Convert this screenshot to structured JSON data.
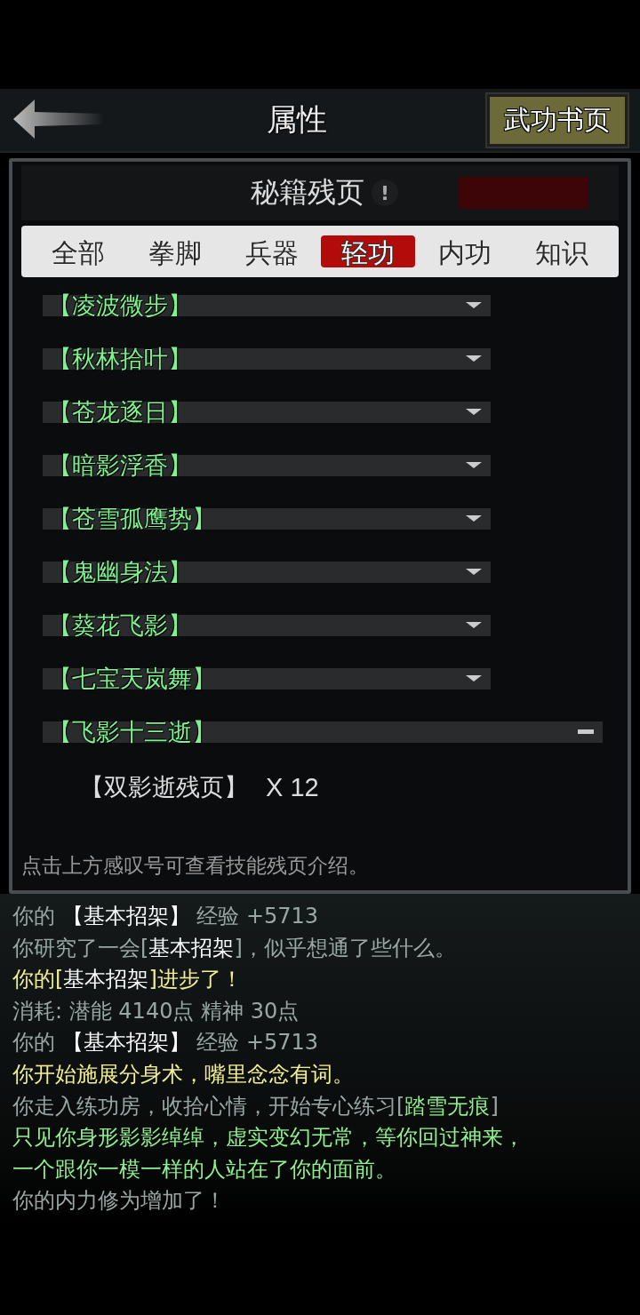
{
  "header": {
    "title": "属性",
    "action": "武功书页"
  },
  "panel": {
    "title": "秘籍残页",
    "info": "!",
    "categories": [
      {
        "label": "全部",
        "selected": false
      },
      {
        "label": "拳脚",
        "selected": false
      },
      {
        "label": "兵器",
        "selected": false
      },
      {
        "label": "轻功",
        "selected": true
      },
      {
        "label": "内功",
        "selected": false
      },
      {
        "label": "知识",
        "selected": false
      }
    ],
    "skills": [
      {
        "name": "【凌波微步】",
        "expanded": false
      },
      {
        "name": "【秋林拾叶】",
        "expanded": false
      },
      {
        "name": "【苍龙逐日】",
        "expanded": false
      },
      {
        "name": "【暗影浮香】",
        "expanded": false
      },
      {
        "name": "【苍雪孤鹰势】",
        "expanded": false
      },
      {
        "name": "【鬼幽身法】",
        "expanded": false
      },
      {
        "name": "【葵花飞影】",
        "expanded": false
      },
      {
        "name": "【七宝天岚舞】",
        "expanded": false
      },
      {
        "name": "【飞影十三逝】",
        "expanded": true,
        "children": [
          {
            "name": "【双影逝残页】",
            "count": "X 12"
          }
        ]
      }
    ],
    "hint": "点击上方感叹号可查看技能残页介绍。"
  },
  "log": [
    [
      {
        "color": "#9aa7a4",
        "text": "你的 "
      },
      {
        "color": "#ffffff",
        "text": "【基本招架】"
      },
      {
        "color": "#9aa7a4",
        "text": " 经验 +5713"
      }
    ],
    [
      {
        "color": "#9aa7a4",
        "text": "你研究了一会["
      },
      {
        "color": "#ffffff",
        "text": "基本招架"
      },
      {
        "color": "#9aa7a4",
        "text": "]，似乎想通了些什么。"
      }
    ],
    [
      {
        "color": "#f2ee93",
        "text": "你的["
      },
      {
        "color": "#ffffff",
        "text": "基本招架"
      },
      {
        "color": "#f2ee93",
        "text": "]进步了！"
      }
    ],
    [
      {
        "color": "#9aa7a4",
        "text": "消耗: 潜能 4140点  精神 30点"
      }
    ],
    [
      {
        "color": "#9aa7a4",
        "text": "你的 "
      },
      {
        "color": "#ffffff",
        "text": "【基本招架】"
      },
      {
        "color": "#9aa7a4",
        "text": " 经验 +5713"
      }
    ],
    [
      {
        "color": "#f2ee93",
        "text": "你开始施展分身术，嘴里念念有词。"
      }
    ],
    [
      {
        "color": "#9aa7a4",
        "text": "你走入练功房，收拾心情，开始专心练习["
      },
      {
        "color": "#8ff08e",
        "text": "踏雪无痕"
      },
      {
        "color": "#9aa7a4",
        "text": "]"
      }
    ],
    [
      {
        "color": "#8ff08e",
        "text": "只见你身形影影绰绰，虚实变幻无常，等你回过神来，"
      }
    ],
    [
      {
        "color": "#8ff08e",
        "text": "一个跟你一模一样的人站在了你的面前。"
      }
    ],
    [
      {
        "color": "#9aa7a4",
        "text": "你的内力修为增加了！"
      }
    ]
  ]
}
